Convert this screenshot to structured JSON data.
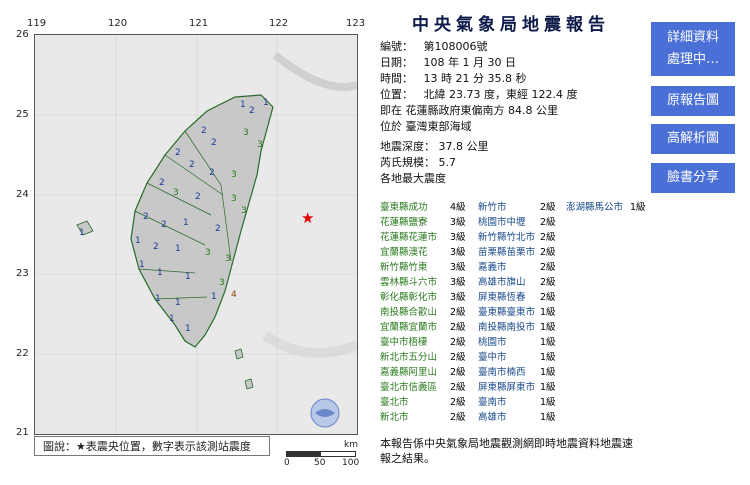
{
  "map": {
    "lon_ticks": [
      "119",
      "120",
      "121",
      "122",
      "123"
    ],
    "lat_ticks": [
      "26",
      "25",
      "24",
      "23",
      "22",
      "21"
    ],
    "legend": "圖說：★表震央位置，數字表示該測站震度",
    "scale_unit": "km",
    "scale_ticks": [
      "0",
      "50",
      "100"
    ]
  },
  "report": {
    "title": "中央氣象局地震報告",
    "number_label": "編號：",
    "number": "第108006號",
    "date_label": "日期：",
    "date": "108 年 1 月 30 日",
    "time_label": "時間：",
    "time": "13 時 21 分 35.8 秒",
    "location_label": "位置：",
    "location": "北緯 23.73 度，東經 122.4 度",
    "location_line2": "即在 花蓮縣政府東偏南方 84.8 公里",
    "location_line3": "位於 臺灣東部海域",
    "depth_label": "地震深度：",
    "depth": "37.8 公里",
    "magnitude_label": "芮氏規模：",
    "magnitude": "5.7",
    "intensity_heading": "各地最大震度",
    "note": "本報告係中央氣象局地震觀測網即時地震資料地震速報之結果。"
  },
  "intensity_rows": [
    {
      "a": "臺東縣成功",
      "av": "4級",
      "b": "新竹市",
      "bv": "2級",
      "c": "澎湖縣馬公市",
      "cv": "1級"
    },
    {
      "a": "花蓮縣鹽寮",
      "av": "3級",
      "b": "桃園市中壢",
      "bv": "2級",
      "c": "",
      "cv": ""
    },
    {
      "a": "花蓮縣花蓮市",
      "av": "3級",
      "b": "新竹縣竹北市",
      "bv": "2級",
      "c": "",
      "cv": ""
    },
    {
      "a": "宜蘭縣澳花",
      "av": "3級",
      "b": "苗栗縣苗栗市",
      "bv": "2級",
      "c": "",
      "cv": ""
    },
    {
      "a": "新竹縣竹東",
      "av": "3級",
      "b": "嘉義市",
      "bv": "2級",
      "c": "",
      "cv": ""
    },
    {
      "a": "雲林縣斗六市",
      "av": "3級",
      "b": "高雄市旗山",
      "bv": "2級",
      "c": "",
      "cv": ""
    },
    {
      "a": "彰化縣彰化市",
      "av": "3級",
      "b": "屏東縣恆春",
      "bv": "2級",
      "c": "",
      "cv": ""
    },
    {
      "a": "南投縣合歡山",
      "av": "2級",
      "b": "臺東縣臺東市",
      "bv": "1級",
      "c": "",
      "cv": ""
    },
    {
      "a": "宜蘭縣宜蘭市",
      "av": "2級",
      "b": "南投縣南投市",
      "bv": "1級",
      "c": "",
      "cv": ""
    },
    {
      "a": "臺中市梧棲",
      "av": "2級",
      "b": "桃園市",
      "bv": "1級",
      "c": "",
      "cv": ""
    },
    {
      "a": "新北市五分山",
      "av": "2級",
      "b": "臺中市",
      "bv": "1級",
      "c": "",
      "cv": ""
    },
    {
      "a": "嘉義縣阿里山",
      "av": "2級",
      "b": "臺南市楠西",
      "bv": "1級",
      "c": "",
      "cv": ""
    },
    {
      "a": "臺北市信義區",
      "av": "2級",
      "b": "屏東縣屏東市",
      "bv": "1級",
      "c": "",
      "cv": ""
    },
    {
      "a": "臺北市",
      "av": "2級",
      "b": "臺南市",
      "bv": "1級",
      "c": "",
      "cv": ""
    },
    {
      "a": "新北市",
      "av": "2級",
      "b": "高雄市",
      "bv": "1級",
      "c": "",
      "cv": ""
    }
  ],
  "sidebar": {
    "detail_line1": "詳細資料",
    "detail_line2": "處理中…",
    "original": "原報告圖",
    "hires": "高解析圖",
    "facebook": "臉書分享"
  },
  "colors": {
    "button_bg": "#4a6fd6",
    "star": "#e00000",
    "title": "#0d1a4a"
  }
}
